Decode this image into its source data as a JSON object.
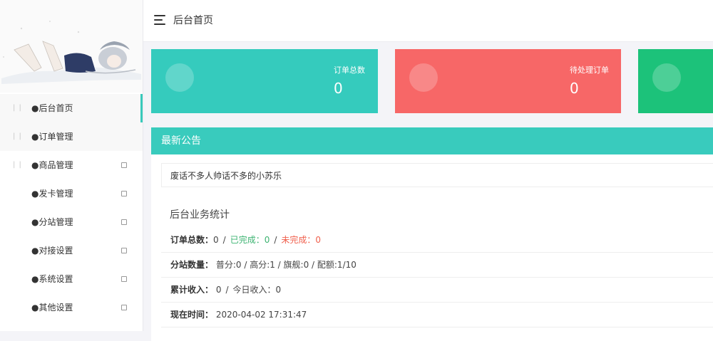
{
  "header": {
    "title": "后台首页"
  },
  "sidebar": {
    "items": [
      {
        "prefix": "| |",
        "label": "●后台首页",
        "arrow": false
      },
      {
        "prefix": "| |",
        "label": "●订单管理",
        "arrow": false
      },
      {
        "prefix": "| |",
        "label": "●商品管理",
        "arrow": true
      },
      {
        "prefix": "",
        "label": "●发卡管理",
        "arrow": true
      },
      {
        "prefix": "",
        "label": "●分站管理",
        "arrow": true
      },
      {
        "prefix": "",
        "label": "●对接设置",
        "arrow": true
      },
      {
        "prefix": "",
        "label": "●系统设置",
        "arrow": true
      },
      {
        "prefix": "",
        "label": "●其他设置",
        "arrow": true
      }
    ]
  },
  "cards": [
    {
      "title": "订单总数",
      "value": "0",
      "color": "#35cbbd"
    },
    {
      "title": "待处理订单",
      "value": "0",
      "color": "#f76767"
    },
    {
      "title": "",
      "value": "",
      "color": "#1cc27a"
    }
  ],
  "panel": {
    "title": "最新公告",
    "notice": "废话不多人帅话不多的小苏乐",
    "stats_title": "后台业务统计",
    "orders": {
      "label": "订单总数：",
      "total": "0",
      "sep": "/",
      "done_label": "已完成：",
      "done": "0",
      "undone_label": "未完成：",
      "undone": "0"
    },
    "substations": {
      "label": "分站数量：",
      "value": "普分:0 / 高分:1 / 旗舰:0 / 配额:1/10"
    },
    "income": {
      "label": "累计收入：",
      "total": "0",
      "sep": "/",
      "today_label": "今日收入：",
      "today": "0"
    },
    "time": {
      "label": "现在时间：",
      "value": "2020-04-02 17:31:47"
    }
  },
  "colors": {
    "accent": "#39cbbd",
    "danger": "#f76767",
    "success": "#1cc27a",
    "done_text": "#3cb371",
    "undone_text": "#f0604d"
  }
}
